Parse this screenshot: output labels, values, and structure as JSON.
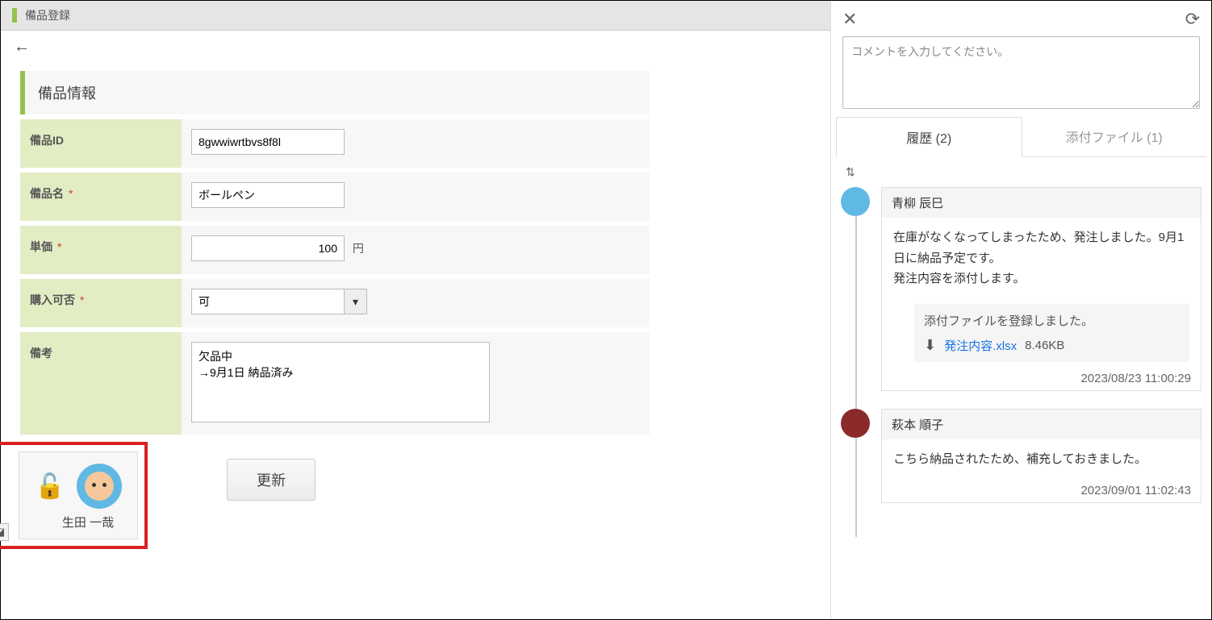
{
  "title": "備品登録",
  "section_title": "備品情報",
  "fields": {
    "id": {
      "label": "備品ID",
      "value": "8gwwiwrtbvs8f8l",
      "required": false
    },
    "name": {
      "label": "備品名",
      "value": "ボールペン",
      "required": true
    },
    "price": {
      "label": "単価",
      "value": "100",
      "unit": "円",
      "required": true
    },
    "purchasable": {
      "label": "購入可否",
      "value": "可",
      "required": true
    },
    "note": {
      "label": "備考",
      "value": "欠品中\n→9月1日 納品済み",
      "required": false
    }
  },
  "update_label": "更新",
  "lock_user": "生田 一哉",
  "side": {
    "comment_placeholder": "コメントを入力してください。",
    "tabs": {
      "history": "履歴 (2)",
      "attachments": "添付ファイル (1)"
    },
    "comments": [
      {
        "author": "青柳 辰巳",
        "body": "在庫がなくなってしまったため、発注しました。9月1日に納品予定です。\n発注内容を添付します。",
        "attach_msg": "添付ファイルを登録しました。",
        "file_name": "発注内容.xlsx",
        "file_size": "8.46KB",
        "time": "2023/08/23 11:00:29"
      },
      {
        "author": "萩本 順子",
        "body": "こちら納品されたため、補充しておきました。",
        "time": "2023/09/01 11:02:43"
      }
    ]
  }
}
